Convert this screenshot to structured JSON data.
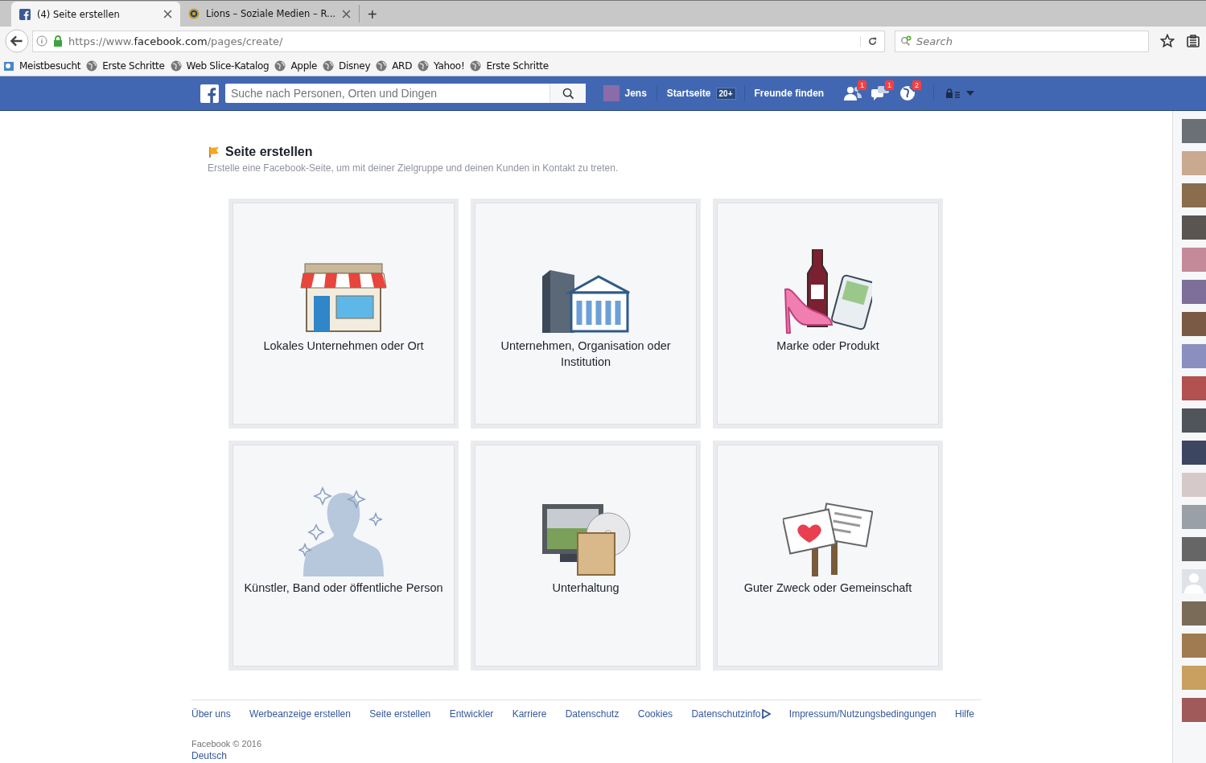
{
  "browser": {
    "tabs": [
      {
        "title": "(4) Seite erstellen",
        "selected": true,
        "kind": "facebook"
      },
      {
        "title": "Lions – Soziale Medien – R...",
        "selected": false,
        "kind": "lions"
      }
    ],
    "new_tab": "+",
    "url": {
      "prefix": "https://www.",
      "domain": "facebook.com",
      "path": "/pages/create/"
    },
    "search": {
      "placeholder": "Search"
    },
    "bookmarks": [
      {
        "label": "Meistbesucht",
        "kind": "folder"
      },
      {
        "label": "Erste Schritte",
        "kind": "globe"
      },
      {
        "label": "Web Slice-Katalog",
        "kind": "globe"
      },
      {
        "label": "Apple",
        "kind": "globe"
      },
      {
        "label": "Disney",
        "kind": "globe"
      },
      {
        "label": "ARD",
        "kind": "globe"
      },
      {
        "label": "Yahoo!",
        "kind": "globe"
      },
      {
        "label": "Erste Schritte",
        "kind": "globe"
      }
    ]
  },
  "topbar": {
    "search": {
      "placeholder": "Suche nach Personen, Orten und Dingen"
    },
    "user": "Jens",
    "home": "Startseite",
    "home_badge": "20+",
    "find_friends": "Freunde finden",
    "notifications": [
      {
        "kind": "friends",
        "count": "1"
      },
      {
        "kind": "messages",
        "count": "1"
      },
      {
        "kind": "globe",
        "count": "2"
      }
    ]
  },
  "page": {
    "title": "Seite erstellen",
    "subtitle": "Erstelle eine Facebook-Seite, um mit deiner Zielgruppe und deinen Kunden in Kontakt zu treten.",
    "categories": [
      {
        "kind": "store",
        "label": "Lokales Unternehmen oder Ort"
      },
      {
        "kind": "company",
        "label": "Unternehmen, Organisation oder Institution"
      },
      {
        "kind": "brand",
        "label": "Marke oder Produkt"
      },
      {
        "kind": "artist",
        "label": "Künstler, Band oder öffentliche Person"
      },
      {
        "kind": "entertainment",
        "label": "Unterhaltung"
      },
      {
        "kind": "cause",
        "label": "Guter Zweck oder Gemeinschaft"
      }
    ]
  },
  "footer": {
    "links": [
      "Über uns",
      "Werbeanzeige erstellen",
      "Seite erstellen",
      "Entwickler",
      "Karriere",
      "Datenschutz",
      "Cookies",
      "Datenschutzinfo",
      "Impressum/Nutzungsbedingungen",
      "Hilfe"
    ],
    "copyright": "Facebook © 2016",
    "language": "Deutsch"
  },
  "chat_sidebar": {
    "contacts": [
      {
        "kind": "photo"
      },
      {
        "kind": "photo"
      },
      {
        "kind": "photo"
      },
      {
        "kind": "photo"
      },
      {
        "kind": "photo"
      },
      {
        "kind": "photo"
      },
      {
        "kind": "photo"
      },
      {
        "kind": "photo"
      },
      {
        "kind": "photo"
      },
      {
        "kind": "photo"
      },
      {
        "kind": "photo"
      },
      {
        "kind": "photo"
      },
      {
        "kind": "photo"
      },
      {
        "kind": "photo"
      },
      {
        "kind": "silhouette"
      },
      {
        "kind": "photo"
      },
      {
        "kind": "photo"
      },
      {
        "kind": "photo"
      },
      {
        "kind": "photo"
      }
    ]
  }
}
